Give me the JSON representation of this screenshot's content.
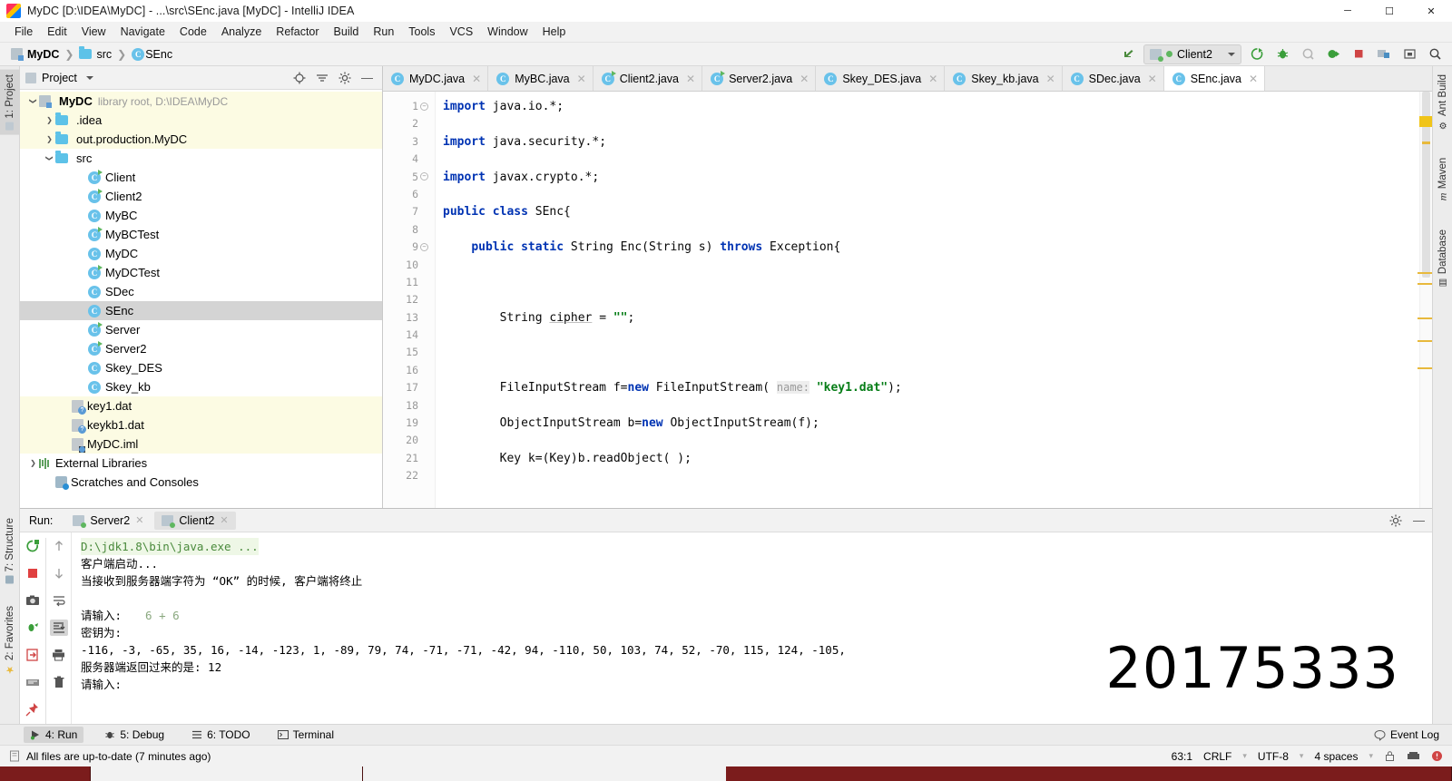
{
  "window": {
    "title": "MyDC [D:\\IDEA\\MyDC] - ...\\src\\SEnc.java [MyDC] - IntelliJ IDEA",
    "minimize": "─",
    "maximize": "☐",
    "close": "✕"
  },
  "menu": [
    "File",
    "Edit",
    "View",
    "Navigate",
    "Code",
    "Analyze",
    "Refactor",
    "Build",
    "Run",
    "Tools",
    "VCS",
    "Window",
    "Help"
  ],
  "breadcrumb": [
    {
      "label": "MyDC",
      "icon": "module-icon"
    },
    {
      "label": "src",
      "icon": "folder-icon"
    },
    {
      "label": "SEnc",
      "icon": "class-icon"
    }
  ],
  "toolbar": {
    "run_configuration": "Client2",
    "icons": [
      "back-arrow-icon",
      "run-icon",
      "debug-icon",
      "coverage-icon",
      "profile-icon",
      "stop-icon",
      "project-structure-icon",
      "settings-sync-icon",
      "search-everywhere-icon"
    ]
  },
  "left_tool_strip": [
    {
      "label": "1: Project",
      "selected": true
    },
    {
      "label": "7: Structure",
      "selected": false
    },
    {
      "label": "2: Favorites",
      "selected": false
    }
  ],
  "right_tool_strip": [
    {
      "label": "Ant Build"
    },
    {
      "label": "Maven"
    },
    {
      "label": "Database"
    }
  ],
  "project_panel": {
    "title": "Project",
    "header_icons": [
      "locate-icon",
      "collapse-all-icon",
      "gear-icon",
      "hide-icon"
    ],
    "tree": [
      {
        "label": "MyDC",
        "detail": "library root,  D:\\IDEA\\MyDC",
        "indent": 0,
        "arrow": "down",
        "icon": "module-icon",
        "bold": true,
        "highlight": true
      },
      {
        "label": ".idea",
        "detail": "",
        "indent": 1,
        "arrow": "right",
        "icon": "folder-icon",
        "bold": false,
        "highlight": true
      },
      {
        "label": "out.production.MyDC",
        "detail": "",
        "indent": 1,
        "arrow": "right",
        "icon": "folder-icon",
        "bold": false,
        "highlight": true
      },
      {
        "label": "src",
        "detail": "",
        "indent": 1,
        "arrow": "down",
        "icon": "folder-icon",
        "bold": false,
        "highlight": false
      },
      {
        "label": "Client",
        "detail": "",
        "indent": 3,
        "arrow": "",
        "icon": "class-runnable-icon",
        "bold": false,
        "highlight": false
      },
      {
        "label": "Client2",
        "detail": "",
        "indent": 3,
        "arrow": "",
        "icon": "class-runnable-icon",
        "bold": false,
        "highlight": false
      },
      {
        "label": "MyBC",
        "detail": "",
        "indent": 3,
        "arrow": "",
        "icon": "class-icon",
        "bold": false,
        "highlight": false
      },
      {
        "label": "MyBCTest",
        "detail": "",
        "indent": 3,
        "arrow": "",
        "icon": "class-runnable-icon",
        "bold": false,
        "highlight": false
      },
      {
        "label": "MyDC",
        "detail": "",
        "indent": 3,
        "arrow": "",
        "icon": "class-icon",
        "bold": false,
        "highlight": false
      },
      {
        "label": "MyDCTest",
        "detail": "",
        "indent": 3,
        "arrow": "",
        "icon": "class-runnable-icon",
        "bold": false,
        "highlight": false
      },
      {
        "label": "SDec",
        "detail": "",
        "indent": 3,
        "arrow": "",
        "icon": "class-icon",
        "bold": false,
        "highlight": false
      },
      {
        "label": "SEnc",
        "detail": "",
        "indent": 3,
        "arrow": "",
        "icon": "class-icon",
        "bold": false,
        "highlight": false,
        "selected": true
      },
      {
        "label": "Server",
        "detail": "",
        "indent": 3,
        "arrow": "",
        "icon": "class-runnable-icon",
        "bold": false,
        "highlight": false
      },
      {
        "label": "Server2",
        "detail": "",
        "indent": 3,
        "arrow": "",
        "icon": "class-runnable-icon",
        "bold": false,
        "highlight": false
      },
      {
        "label": "Skey_DES",
        "detail": "",
        "indent": 3,
        "arrow": "",
        "icon": "class-icon",
        "bold": false,
        "highlight": false
      },
      {
        "label": "Skey_kb",
        "detail": "",
        "indent": 3,
        "arrow": "",
        "icon": "class-icon",
        "bold": false,
        "highlight": false
      },
      {
        "label": "key1.dat",
        "detail": "",
        "indent": 2,
        "arrow": "",
        "icon": "unknown-file-icon",
        "bold": false,
        "highlight": true
      },
      {
        "label": "keykb1.dat",
        "detail": "",
        "indent": 2,
        "arrow": "",
        "icon": "unknown-file-icon",
        "bold": false,
        "highlight": true
      },
      {
        "label": "MyDC.iml",
        "detail": "",
        "indent": 2,
        "arrow": "",
        "icon": "iml-file-icon",
        "bold": false,
        "highlight": true
      },
      {
        "label": "External Libraries",
        "detail": "",
        "indent": 0,
        "arrow": "right",
        "icon": "library-icon",
        "bold": false,
        "highlight": false
      },
      {
        "label": "Scratches and Consoles",
        "detail": "",
        "indent": 1,
        "arrow": "",
        "icon": "scratches-icon",
        "bold": false,
        "highlight": false
      }
    ]
  },
  "editor": {
    "tabs": [
      {
        "label": "MyDC.java",
        "icon": "class-icon",
        "active": false
      },
      {
        "label": "MyBC.java",
        "icon": "class-icon",
        "active": false
      },
      {
        "label": "Client2.java",
        "icon": "class-runnable-icon",
        "active": false
      },
      {
        "label": "Server2.java",
        "icon": "class-runnable-icon",
        "active": false
      },
      {
        "label": "Skey_DES.java",
        "icon": "class-icon",
        "active": false
      },
      {
        "label": "Skey_kb.java",
        "icon": "class-icon",
        "active": false
      },
      {
        "label": "SDec.java",
        "icon": "class-icon",
        "active": false
      },
      {
        "label": "SEnc.java",
        "icon": "class-icon",
        "active": true
      }
    ],
    "lines": [
      {
        "n": 1,
        "html": "<span class=\"kw\">import</span> java.io.*;"
      },
      {
        "n": 2,
        "html": ""
      },
      {
        "n": 3,
        "html": "<span class=\"kw\">import</span> java.security.*;"
      },
      {
        "n": 4,
        "html": ""
      },
      {
        "n": 5,
        "html": "<span class=\"kw\">import</span> javax.crypto.*;"
      },
      {
        "n": 6,
        "html": ""
      },
      {
        "n": 7,
        "html": "<span class=\"kw\">public class</span> SEnc{"
      },
      {
        "n": 8,
        "html": ""
      },
      {
        "n": 9,
        "html": "    <span class=\"kw\">public static</span> String Enc(String s) <span class=\"kw\">throws</span> Exception{"
      },
      {
        "n": 10,
        "html": ""
      },
      {
        "n": 11,
        "html": ""
      },
      {
        "n": 12,
        "html": ""
      },
      {
        "n": 13,
        "html": "        String <span class=\"fld\">cipher</span> = <span class=\"str\">\"\"</span>;"
      },
      {
        "n": 14,
        "html": ""
      },
      {
        "n": 15,
        "html": ""
      },
      {
        "n": 16,
        "html": ""
      },
      {
        "n": 17,
        "html": "        FileInputStream f=<span class=\"kw\">new</span> FileInputStream( <span class=\"hint\">name:</span> <span class=\"str\">\"key1.dat\"</span>);"
      },
      {
        "n": 18,
        "html": ""
      },
      {
        "n": 19,
        "html": "        ObjectInputStream b=<span class=\"kw\">new</span> ObjectInputStream(f);"
      },
      {
        "n": 20,
        "html": ""
      },
      {
        "n": 21,
        "html": "        Key k=(Key)b.readObject( );"
      },
      {
        "n": 22,
        "html": ""
      }
    ]
  },
  "run_panel": {
    "label": "Run:",
    "tabs": [
      {
        "label": "Server2",
        "active": false
      },
      {
        "label": "Client2",
        "active": true
      }
    ],
    "header_icons": [
      "gear-icon",
      "hide-icon"
    ],
    "tool_buttons_left": [
      "rerun-icon",
      "stop-icon",
      "screenshot-icon",
      "dump-threads-icon",
      "export-icon",
      "console-icon",
      "pin-icon"
    ],
    "tool_buttons_right": [
      "up-icon",
      "down-icon",
      "soft-wrap-icon",
      "scroll-to-end-icon",
      "print-icon",
      "trash-icon"
    ],
    "console": [
      {
        "text": "D:\\jdk1.8\\bin\\java.exe ...",
        "type": "command"
      },
      {
        "text": "客户端启动...",
        "type": "plain"
      },
      {
        "text": "当接收到服务器端字符为 “OK” 的时候, 客户端将终止",
        "type": "plain"
      },
      {
        "text": "",
        "type": "plain"
      },
      {
        "text": "请输入:",
        "input": "6 + 6",
        "type": "input"
      },
      {
        "text": "密钥为:",
        "type": "plain"
      },
      {
        "text": "-116, -3, -65, 35, 16, -14, -123, 1, -89, 79, 74, -71, -71, -42, 94, -110, 50, 103, 74, 52, -70, 115, 124, -105,",
        "type": "plain"
      },
      {
        "text": "服务器端返回过来的是: 12",
        "type": "plain"
      },
      {
        "text": "请输入:",
        "type": "plain"
      }
    ],
    "watermark": "20175333"
  },
  "bottom_bar": {
    "tabs": [
      {
        "label": "4: Run",
        "icon": "run-icon",
        "active": true
      },
      {
        "label": "5: Debug",
        "icon": "debug-icon",
        "active": false
      },
      {
        "label": "6: TODO",
        "icon": "todo-icon",
        "active": false
      },
      {
        "label": "Terminal",
        "icon": "terminal-icon",
        "active": false
      }
    ],
    "event_log": "Event Log"
  },
  "status_bar": {
    "message": "All files are up-to-date (7 minutes ago)",
    "caret": "63:1",
    "line_separator": "CRLF",
    "encoding": "UTF-8",
    "indent": "4 spaces"
  }
}
